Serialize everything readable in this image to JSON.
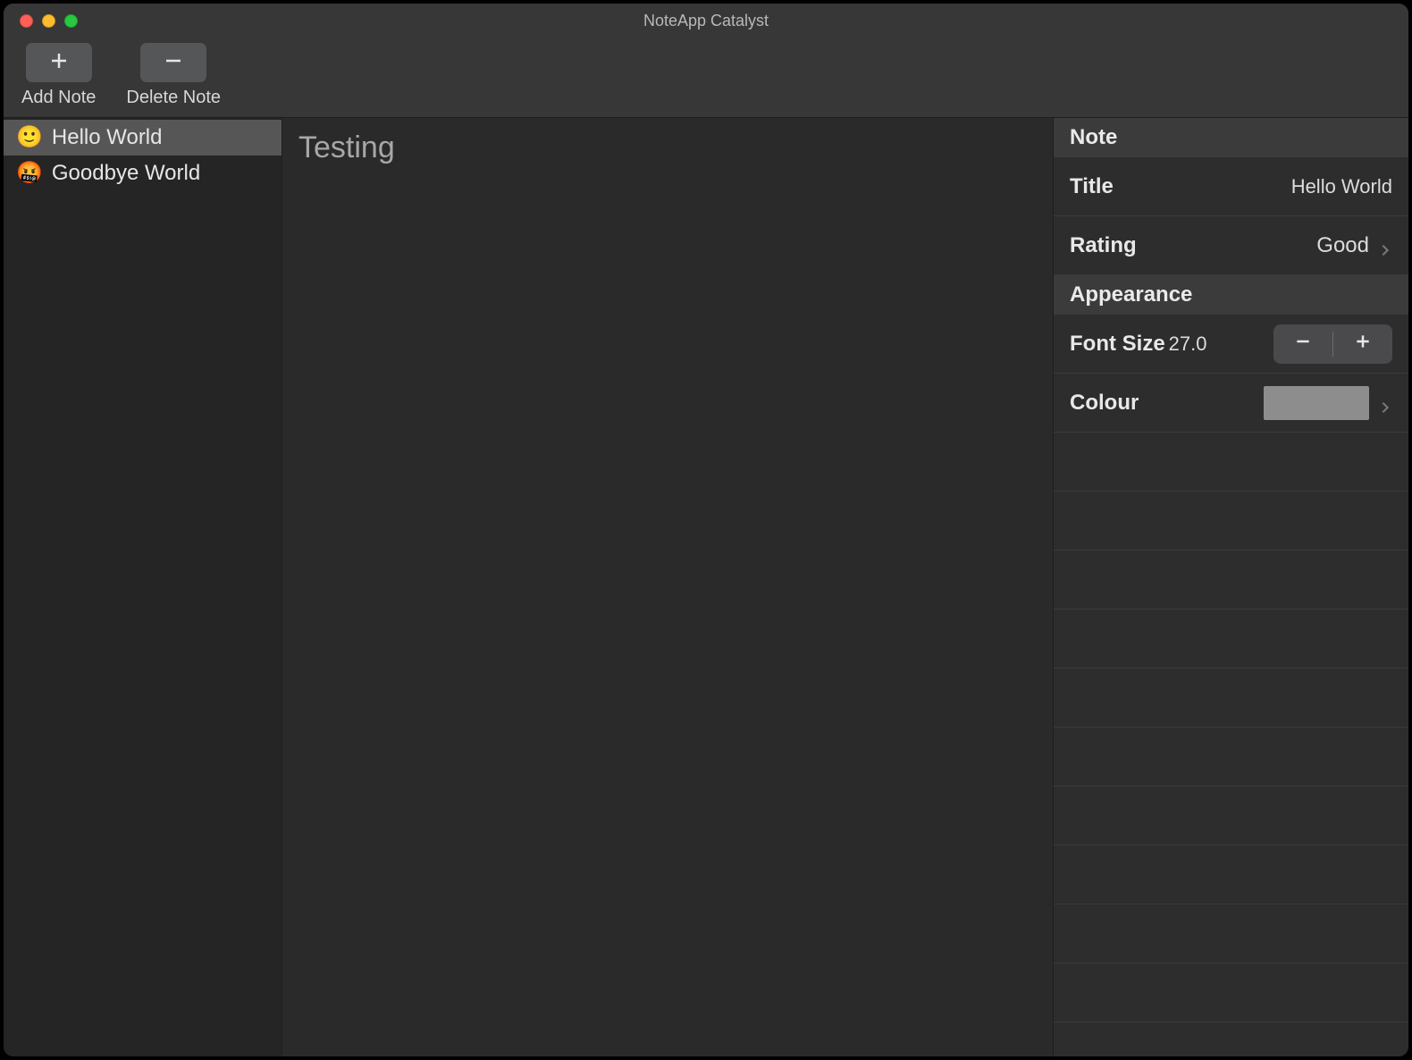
{
  "window": {
    "title": "NoteApp Catalyst"
  },
  "toolbar": {
    "add": {
      "label": "Add Note",
      "icon": "plus-icon"
    },
    "delete": {
      "label": "Delete Note",
      "icon": "minus-icon"
    }
  },
  "sidebar": {
    "items": [
      {
        "emoji": "🙂",
        "title": "Hello World",
        "selected": true
      },
      {
        "emoji": "🤬",
        "title": "Goodbye World",
        "selected": false
      }
    ]
  },
  "editor": {
    "content": "Testing"
  },
  "inspector": {
    "sections": {
      "note": {
        "header": "Note",
        "title_label": "Title",
        "title_value": "Hello World",
        "rating_label": "Rating",
        "rating_value": "Good"
      },
      "appearance": {
        "header": "Appearance",
        "font_size_label": "Font Size",
        "font_size_value": "27.0",
        "colour_label": "Colour",
        "colour_swatch": "#8d8d8d"
      }
    }
  }
}
